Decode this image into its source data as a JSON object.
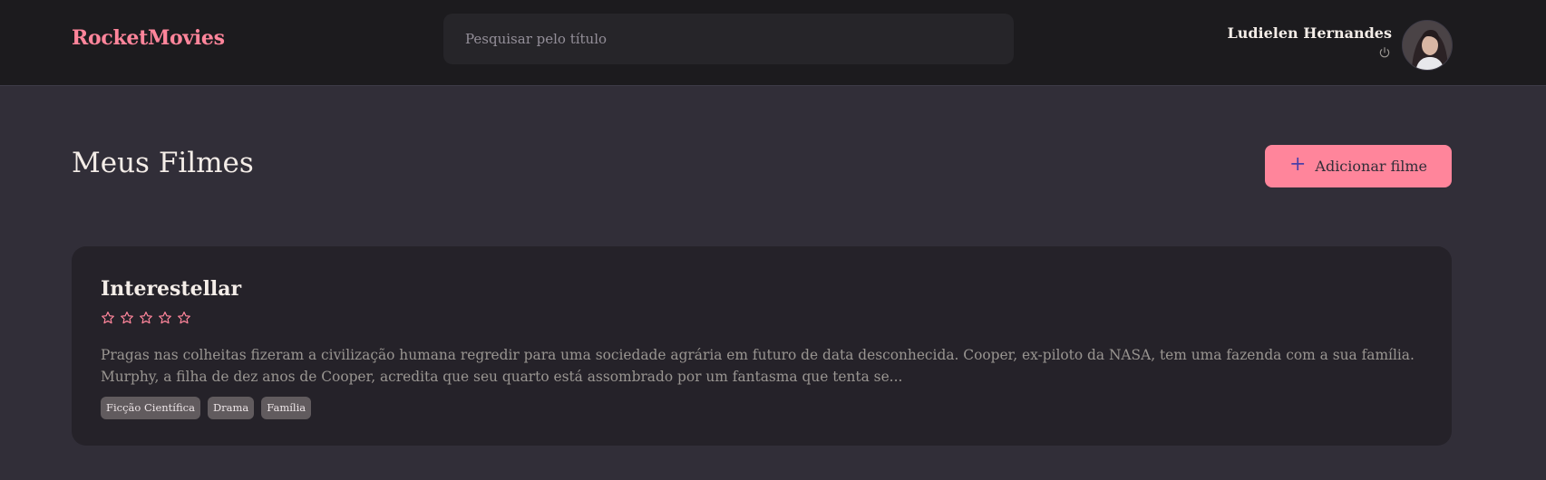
{
  "header": {
    "logo": "RocketMovies",
    "search_placeholder": "Pesquisar pelo título",
    "user_name": "Ludielen Hernandes"
  },
  "main": {
    "title": "Meus Filmes",
    "add_button_label": "Adicionar filme"
  },
  "movies": [
    {
      "title": "Interestellar",
      "rating": 0,
      "rating_max": 5,
      "description": "Pragas nas colheitas fizeram a civilização humana regredir para uma sociedade agrária em futuro de data desconhecida. Cooper, ex-piloto da NASA, tem uma fazenda com a sua família. Murphy, a filha de dez anos de Cooper, acredita que seu quarto está assombrado por um fantasma que tenta se...",
      "tags": [
        "Ficção Científica",
        "Drama",
        "Família"
      ]
    }
  ],
  "colors": {
    "accent": "#ff859b",
    "background": "#312e38",
    "header_bg": "#1c1b1e",
    "card_bg": "#252229",
    "tag_bg": "#615b5e"
  }
}
